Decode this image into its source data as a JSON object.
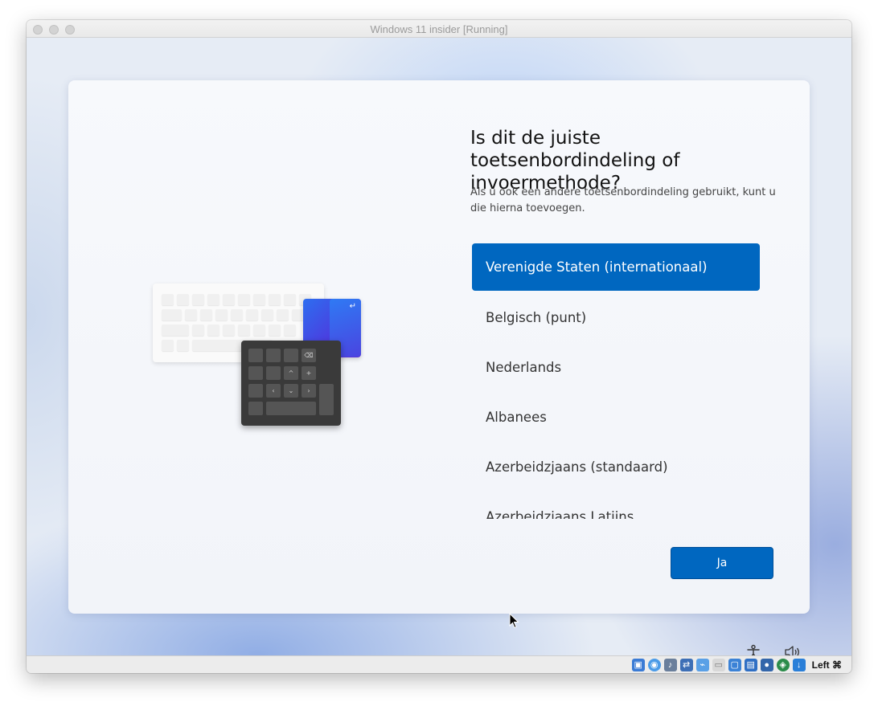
{
  "window": {
    "title": "Windows 11 insider [Running]"
  },
  "setup": {
    "heading": "Is dit de juiste toetsenbordindeling of invoermethode?",
    "subtext": "Als u ook een andere toetsenbordindeling gebruikt, kunt u die hierna toevoegen.",
    "layouts": [
      {
        "label": "Verenigde Staten (internationaal)",
        "selected": true
      },
      {
        "label": "Belgisch (punt)",
        "selected": false
      },
      {
        "label": "Nederlands",
        "selected": false
      },
      {
        "label": "Albanees",
        "selected": false
      },
      {
        "label": "Azerbeidzjaans (standaard)",
        "selected": false
      },
      {
        "label": "Azerbeidzjaans Latijns",
        "selected": false
      }
    ],
    "confirm_label": "Ja",
    "accent_color": "#0067c0"
  },
  "system_tray": {
    "accessibility_icon": "accessibility-icon",
    "volume_icon": "volume-icon"
  },
  "statusbar": {
    "host_key": "Left ⌘",
    "icons": [
      "hard-disk-icon",
      "optical-drive-icon",
      "audio-icon",
      "network-icon",
      "usb-icon",
      "shared-folder-icon",
      "display-icon",
      "screen-capture-icon",
      "recording-icon",
      "cpu-icon",
      "mouse-integration-icon",
      "download-icon"
    ]
  }
}
